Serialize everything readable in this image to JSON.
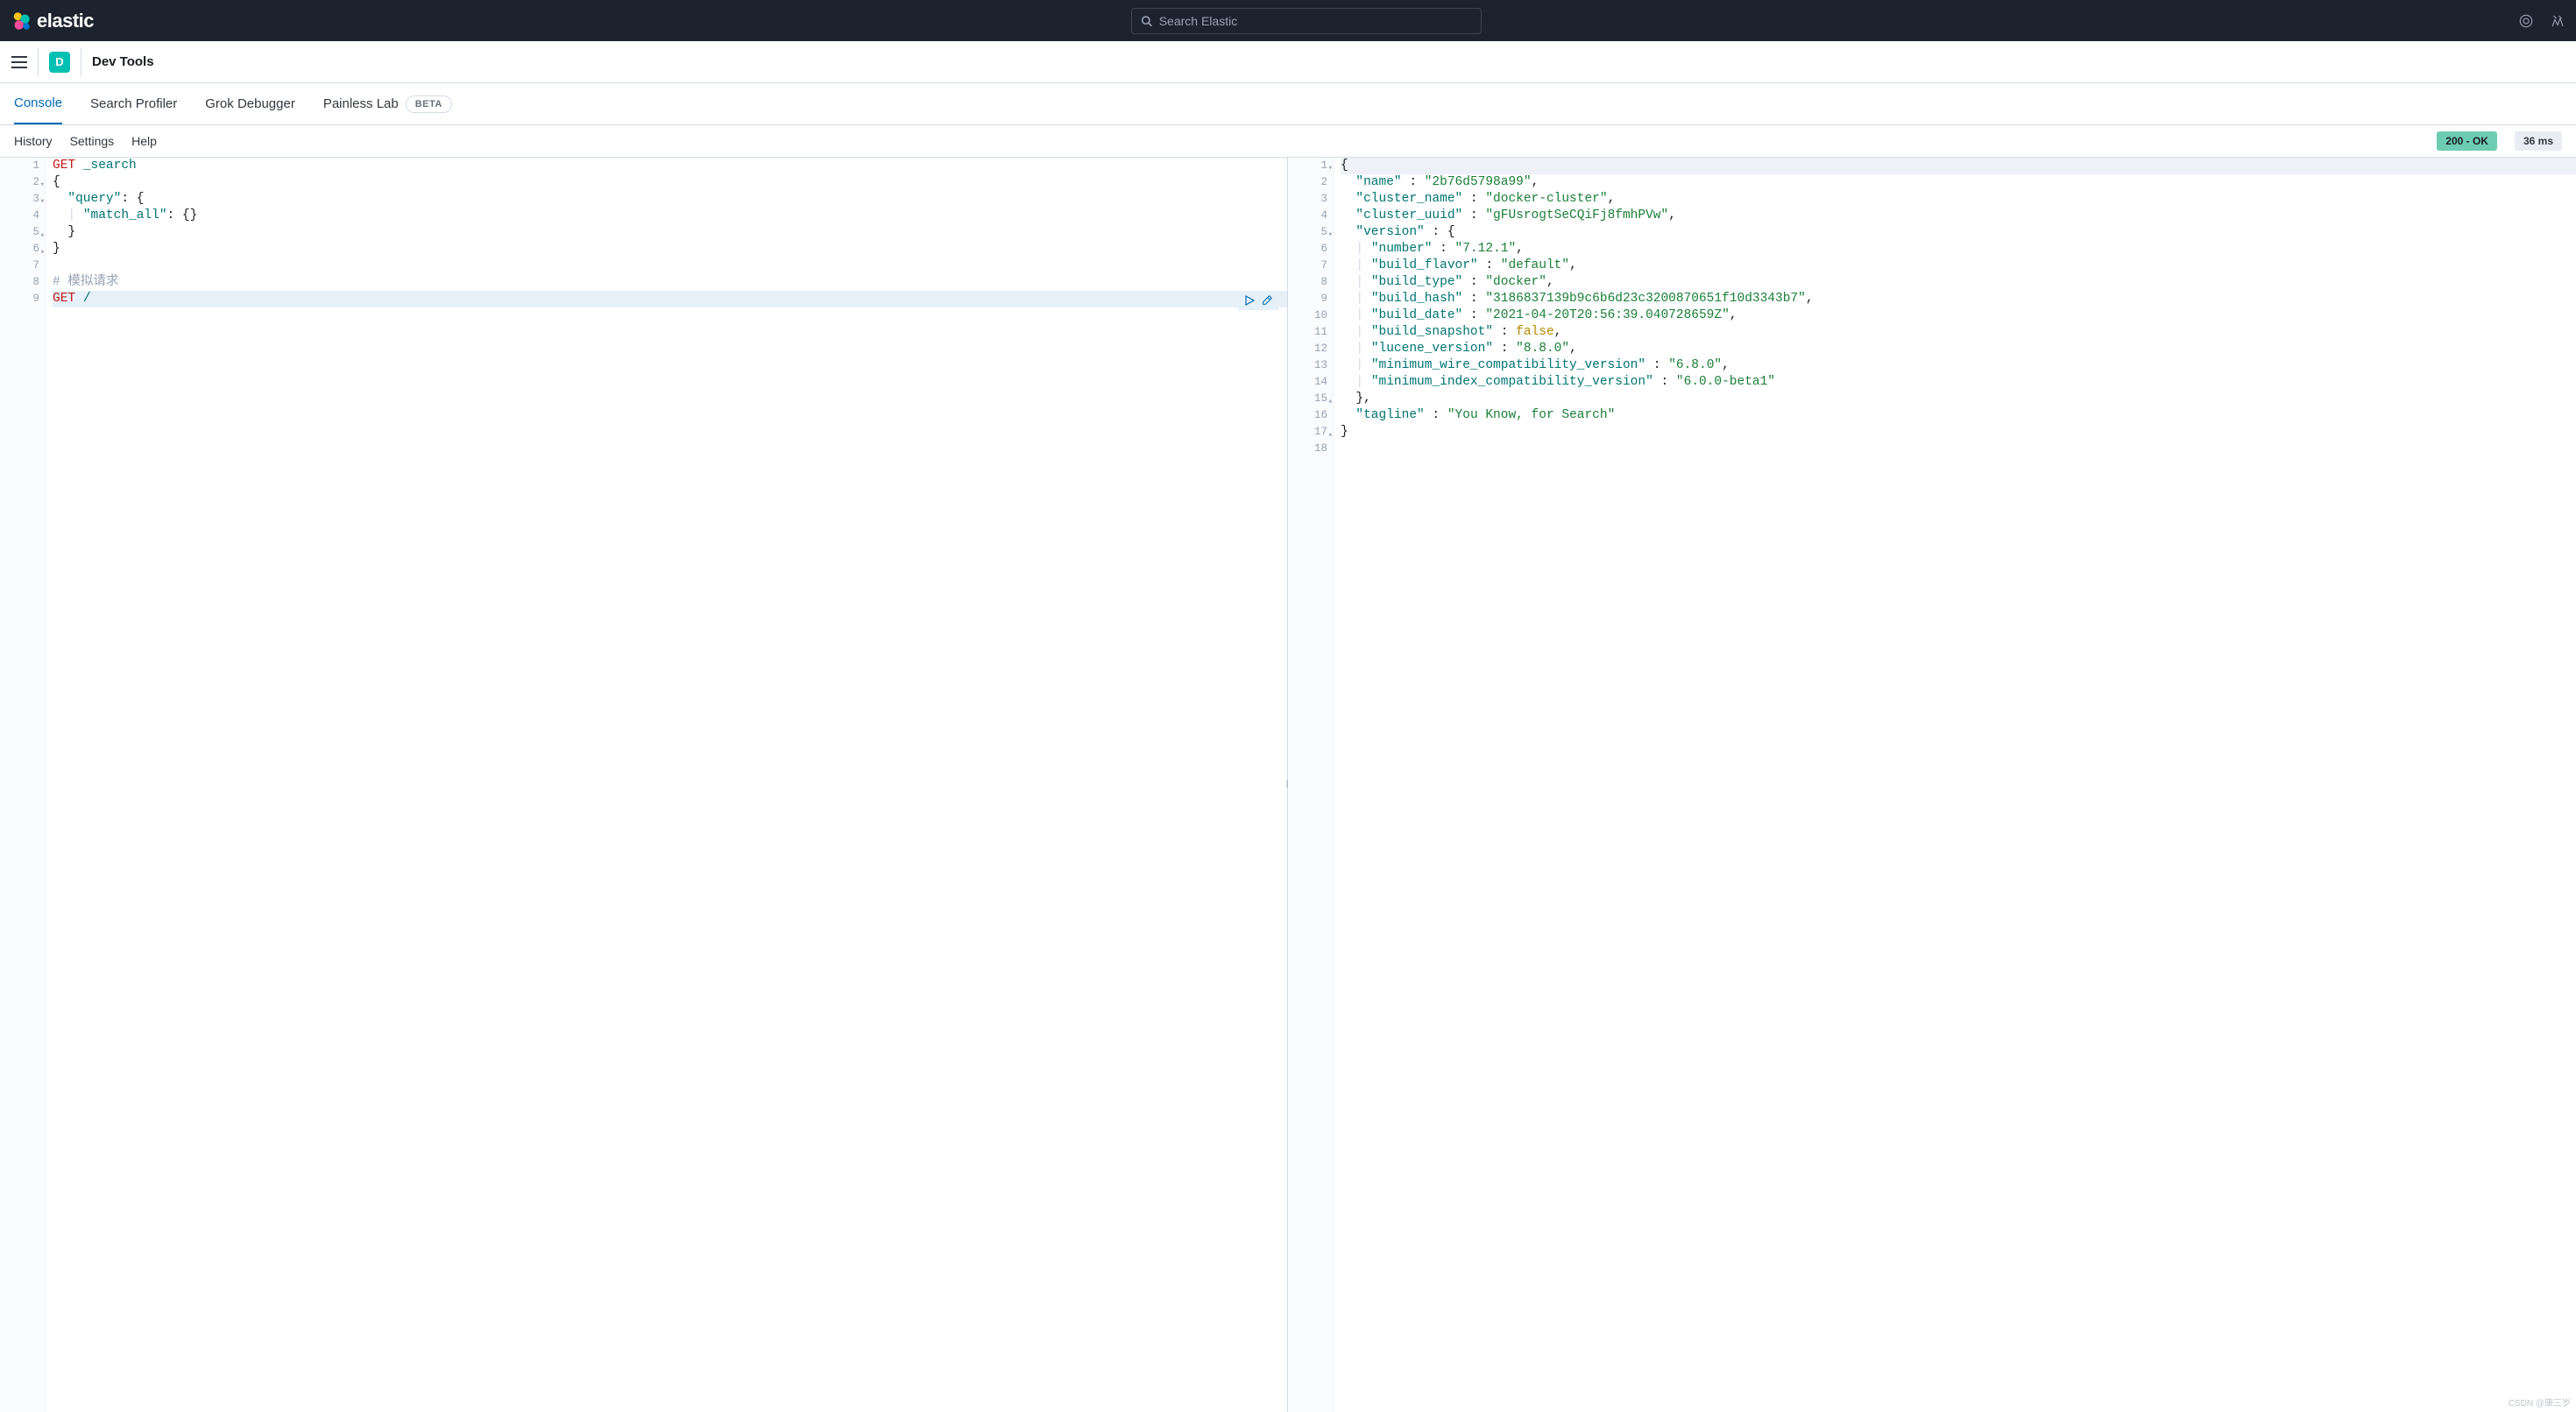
{
  "brand": {
    "name": "elastic"
  },
  "search": {
    "placeholder": "Search Elastic"
  },
  "space": {
    "initial": "D"
  },
  "breadcrumb": "Dev Tools",
  "tabs": [
    {
      "label": "Console",
      "active": true
    },
    {
      "label": "Search Profiler",
      "active": false
    },
    {
      "label": "Grok Debugger",
      "active": false
    },
    {
      "label": "Painless Lab",
      "active": false,
      "badge": "BETA"
    }
  ],
  "submenu": {
    "history": "History",
    "settings": "Settings",
    "help": "Help"
  },
  "status": {
    "code": "200 - OK",
    "time": "36 ms"
  },
  "request_editor": {
    "active_line": 9,
    "lines": [
      {
        "n": 1,
        "tokens": [
          {
            "t": "GET",
            "c": "method"
          },
          {
            "t": " ",
            "c": ""
          },
          {
            "t": "_search",
            "c": "path"
          }
        ]
      },
      {
        "n": 2,
        "fold": true,
        "tokens": [
          {
            "t": "{",
            "c": "punc"
          }
        ]
      },
      {
        "n": 3,
        "fold": true,
        "tokens": [
          {
            "t": "  ",
            "c": ""
          },
          {
            "t": "\"query\"",
            "c": "key"
          },
          {
            "t": ": {",
            "c": "punc"
          }
        ]
      },
      {
        "n": 4,
        "tokens": [
          {
            "t": "  ",
            "c": ""
          },
          {
            "t": "| ",
            "c": "guide"
          },
          {
            "t": "\"match_all\"",
            "c": "key"
          },
          {
            "t": ": {}",
            "c": "punc"
          }
        ]
      },
      {
        "n": 5,
        "foldend": true,
        "tokens": [
          {
            "t": "  }",
            "c": "punc"
          }
        ]
      },
      {
        "n": 6,
        "foldend": true,
        "tokens": [
          {
            "t": "}",
            "c": "punc"
          }
        ]
      },
      {
        "n": 7,
        "tokens": []
      },
      {
        "n": 8,
        "tokens": [
          {
            "t": "# 模拟请求",
            "c": "comment"
          }
        ]
      },
      {
        "n": 9,
        "tokens": [
          {
            "t": "GET",
            "c": "method"
          },
          {
            "t": " ",
            "c": ""
          },
          {
            "t": "/",
            "c": "path"
          }
        ]
      }
    ]
  },
  "response_editor": {
    "lines": [
      {
        "n": 1,
        "fold": true,
        "hl": true,
        "tokens": [
          {
            "t": "{",
            "c": "punc"
          }
        ]
      },
      {
        "n": 2,
        "tokens": [
          {
            "t": "  ",
            "c": ""
          },
          {
            "t": "\"name\"",
            "c": "key"
          },
          {
            "t": " : ",
            "c": "punc"
          },
          {
            "t": "\"2b76d5798a99\"",
            "c": "str"
          },
          {
            "t": ",",
            "c": "punc"
          }
        ]
      },
      {
        "n": 3,
        "tokens": [
          {
            "t": "  ",
            "c": ""
          },
          {
            "t": "\"cluster_name\"",
            "c": "key"
          },
          {
            "t": " : ",
            "c": "punc"
          },
          {
            "t": "\"docker-cluster\"",
            "c": "str"
          },
          {
            "t": ",",
            "c": "punc"
          }
        ]
      },
      {
        "n": 4,
        "tokens": [
          {
            "t": "  ",
            "c": ""
          },
          {
            "t": "\"cluster_uuid\"",
            "c": "key"
          },
          {
            "t": " : ",
            "c": "punc"
          },
          {
            "t": "\"gFUsrogtSeCQiFj8fmhPVw\"",
            "c": "str"
          },
          {
            "t": ",",
            "c": "punc"
          }
        ]
      },
      {
        "n": 5,
        "fold": true,
        "tokens": [
          {
            "t": "  ",
            "c": ""
          },
          {
            "t": "\"version\"",
            "c": "key"
          },
          {
            "t": " : {",
            "c": "punc"
          }
        ]
      },
      {
        "n": 6,
        "tokens": [
          {
            "t": "  ",
            "c": ""
          },
          {
            "t": "| ",
            "c": "guide"
          },
          {
            "t": "\"number\"",
            "c": "key"
          },
          {
            "t": " : ",
            "c": "punc"
          },
          {
            "t": "\"7.12.1\"",
            "c": "str"
          },
          {
            "t": ",",
            "c": "punc"
          }
        ]
      },
      {
        "n": 7,
        "tokens": [
          {
            "t": "  ",
            "c": ""
          },
          {
            "t": "| ",
            "c": "guide"
          },
          {
            "t": "\"build_flavor\"",
            "c": "key"
          },
          {
            "t": " : ",
            "c": "punc"
          },
          {
            "t": "\"default\"",
            "c": "str"
          },
          {
            "t": ",",
            "c": "punc"
          }
        ]
      },
      {
        "n": 8,
        "tokens": [
          {
            "t": "  ",
            "c": ""
          },
          {
            "t": "| ",
            "c": "guide"
          },
          {
            "t": "\"build_type\"",
            "c": "key"
          },
          {
            "t": " : ",
            "c": "punc"
          },
          {
            "t": "\"docker\"",
            "c": "str"
          },
          {
            "t": ",",
            "c": "punc"
          }
        ]
      },
      {
        "n": 9,
        "tokens": [
          {
            "t": "  ",
            "c": ""
          },
          {
            "t": "| ",
            "c": "guide"
          },
          {
            "t": "\"build_hash\"",
            "c": "key"
          },
          {
            "t": " : ",
            "c": "punc"
          },
          {
            "t": "\"3186837139b9c6b6d23c3200870651f10d3343b7\"",
            "c": "str"
          },
          {
            "t": ",",
            "c": "punc"
          }
        ]
      },
      {
        "n": 10,
        "tokens": [
          {
            "t": "  ",
            "c": ""
          },
          {
            "t": "| ",
            "c": "guide"
          },
          {
            "t": "\"build_date\"",
            "c": "key"
          },
          {
            "t": " : ",
            "c": "punc"
          },
          {
            "t": "\"2021-04-20T20:56:39.040728659Z\"",
            "c": "str"
          },
          {
            "t": ",",
            "c": "punc"
          }
        ]
      },
      {
        "n": 11,
        "tokens": [
          {
            "t": "  ",
            "c": ""
          },
          {
            "t": "| ",
            "c": "guide"
          },
          {
            "t": "\"build_snapshot\"",
            "c": "key"
          },
          {
            "t": " : ",
            "c": "punc"
          },
          {
            "t": "false",
            "c": "bool"
          },
          {
            "t": ",",
            "c": "punc"
          }
        ]
      },
      {
        "n": 12,
        "tokens": [
          {
            "t": "  ",
            "c": ""
          },
          {
            "t": "| ",
            "c": "guide"
          },
          {
            "t": "\"lucene_version\"",
            "c": "key"
          },
          {
            "t": " : ",
            "c": "punc"
          },
          {
            "t": "\"8.8.0\"",
            "c": "str"
          },
          {
            "t": ",",
            "c": "punc"
          }
        ]
      },
      {
        "n": 13,
        "tokens": [
          {
            "t": "  ",
            "c": ""
          },
          {
            "t": "| ",
            "c": "guide"
          },
          {
            "t": "\"minimum_wire_compatibility_version\"",
            "c": "key"
          },
          {
            "t": " : ",
            "c": "punc"
          },
          {
            "t": "\"6.8.0\"",
            "c": "str"
          },
          {
            "t": ",",
            "c": "punc"
          }
        ]
      },
      {
        "n": 14,
        "tokens": [
          {
            "t": "  ",
            "c": ""
          },
          {
            "t": "| ",
            "c": "guide"
          },
          {
            "t": "\"minimum_index_compatibility_version\"",
            "c": "key"
          },
          {
            "t": " : ",
            "c": "punc"
          },
          {
            "t": "\"6.0.0-beta1\"",
            "c": "str"
          }
        ]
      },
      {
        "n": 15,
        "foldend": true,
        "tokens": [
          {
            "t": "  },",
            "c": "punc"
          }
        ]
      },
      {
        "n": 16,
        "tokens": [
          {
            "t": "  ",
            "c": ""
          },
          {
            "t": "\"tagline\"",
            "c": "key"
          },
          {
            "t": " : ",
            "c": "punc"
          },
          {
            "t": "\"You Know, for Search\"",
            "c": "str"
          }
        ]
      },
      {
        "n": 17,
        "foldend": true,
        "tokens": [
          {
            "t": "}",
            "c": "punc"
          }
        ]
      },
      {
        "n": 18,
        "tokens": []
      }
    ]
  },
  "watermark": "CSDN @康三岁"
}
